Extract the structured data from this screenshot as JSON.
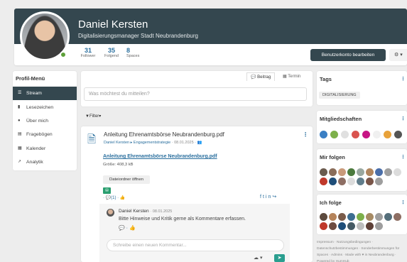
{
  "profile": {
    "name": "Daniel Kersten",
    "title": "Digitalisierungsmanager Stadt Neubrandenburg",
    "stats": [
      {
        "count": "31",
        "label": "Follower"
      },
      {
        "count": "35",
        "label": "Folgend"
      },
      {
        "count": "8",
        "label": "Spaces"
      }
    ],
    "edit_button": "Benutzerkonto bearbeiten",
    "gear_button": "⚙ ▾"
  },
  "menu": {
    "title": "Profil-Menü",
    "items": [
      {
        "label": "Stream",
        "icon": "stream-icon",
        "glyph": "☰"
      },
      {
        "label": "Lesezeichen",
        "icon": "bookmark-icon",
        "glyph": "▮"
      },
      {
        "label": "Über mich",
        "icon": "info-icon",
        "glyph": "●"
      },
      {
        "label": "Fragebögen",
        "icon": "list-icon",
        "glyph": "▤"
      },
      {
        "label": "Kalender",
        "icon": "calendar-icon",
        "glyph": "▦"
      },
      {
        "label": "Analytik",
        "icon": "chart-icon",
        "glyph": "↗"
      }
    ]
  },
  "composer": {
    "tab_post": "Beitrag",
    "tab_event": "Termin",
    "placeholder": "Was möchtest du mitteilen?"
  },
  "filter_label": "Filter",
  "post": {
    "title": "Anleitung Ehrenamtsbörse Neubrandenburg.pdf",
    "author": "Daniel Kersten",
    "space": "Engagementstrategie",
    "date": "08.01.2025",
    "file_link": "Anleitung Ehrenamtsbörse Neubrandenburg.pdf",
    "file_size": "Größe: 408,3 kB",
    "folder_button": "Dateiordner öffnen",
    "comment_count": "(1)"
  },
  "comment": {
    "author": "Daniel Kersten",
    "date": "08.01.2025",
    "text": "Bitte Hinweise und Kritik gerne als Kommentare erfassen.",
    "input_placeholder": "Schreibe einen neuen Kommentar..."
  },
  "sidebar": {
    "tags_title": "Tags",
    "tag": "DIGITALISIERUNG",
    "memberships_title": "Mitgliedschaften",
    "followers_title": "Mir folgen",
    "following_title": "Ich folge"
  },
  "footer": "Impressum · Nutzungsbedingungen · Datenschutzbestimmungen · Sonderbestimmungen für Spaces · Admins · Made with ♥ in Neubrandenburg · Powered by HumHub",
  "colors": {
    "header": "#34474f",
    "accent": "#2a6f9e",
    "online": "#5ea03a"
  }
}
